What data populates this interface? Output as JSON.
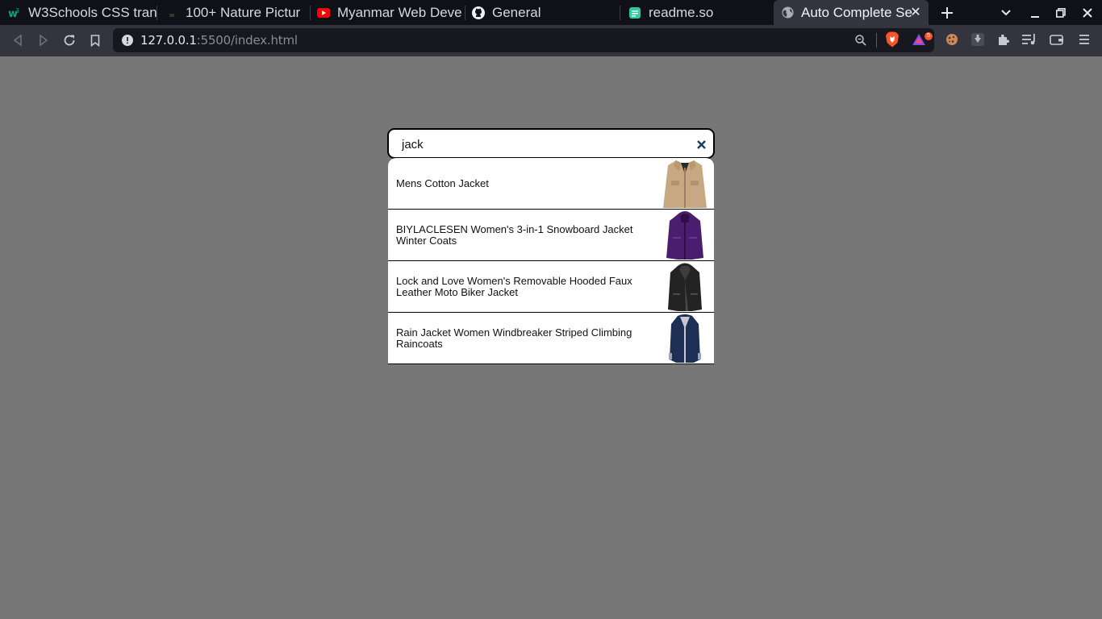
{
  "browser": {
    "tabs": [
      {
        "title": "W3Schools CSS tran",
        "icon": "w3schools-icon"
      },
      {
        "title": "100+ Nature Pictur",
        "icon": "unsplash-icon"
      },
      {
        "title": "Myanmar Web Deve",
        "icon": "youtube-icon"
      },
      {
        "title": "General",
        "icon": "github-icon"
      },
      {
        "title": "readme.so",
        "icon": "readme-icon"
      },
      {
        "title": "Auto Complete Se",
        "icon": "globe-icon",
        "active": true
      }
    ],
    "url": {
      "host": "127.0.0.1",
      "rest": ":5500/index.html"
    },
    "shields_badge": "5",
    "colors": {
      "tabbar": "#0f1018",
      "toolbar": "#33343e",
      "urlbar": "#16171f",
      "brave": "#fb542b"
    }
  },
  "search": {
    "value": "jack",
    "clear_icon": "close-icon"
  },
  "results": [
    {
      "name": "Mens Cotton Jacket",
      "image": "tan-cotton-jacket",
      "color": "#c7a882"
    },
    {
      "name": "BIYLACLESEN Women's 3-in-1 Snowboard Jacket Winter Coats",
      "image": "purple-snowboard-jacket",
      "color": "#4b1d6e"
    },
    {
      "name": "Lock and Love Women's Removable Hooded Faux Leather Moto Biker Jacket",
      "image": "black-leather-jacket",
      "color": "#232323"
    },
    {
      "name": "Rain Jacket Women Windbreaker Striped Climbing Raincoats",
      "image": "navy-rain-jacket",
      "color": "#1e2f55"
    }
  ],
  "page": {
    "background": "#777777"
  }
}
